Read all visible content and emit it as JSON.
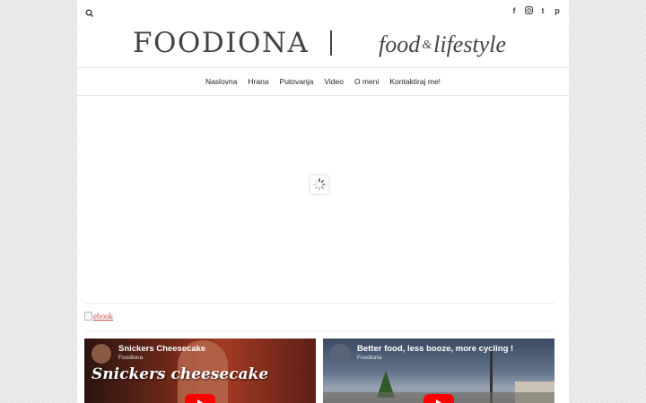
{
  "header": {
    "logo_main": "FOODIONA",
    "tagline_left": "food",
    "tagline_amp": "&",
    "tagline_right": "lifestyle",
    "social_icons": [
      "facebook-icon",
      "instagram-icon",
      "tumblr-icon",
      "pinterest-icon"
    ]
  },
  "nav": {
    "items": [
      "Naslovna",
      "Hrana",
      "Putovanja",
      "Video",
      "O meni",
      "Kontaktiraj me!"
    ]
  },
  "ebook": {
    "alt_text": "ebook"
  },
  "videos": [
    {
      "title": "Snickers Cheesecake",
      "channel": "Foodiona",
      "overlay_text": "Snickers cheesecake"
    },
    {
      "title": "Better food, less booze, more cycling !",
      "channel": "Foodiona"
    }
  ],
  "colors": {
    "background": "#e9e9e9",
    "page": "#ffffff",
    "text": "#444444",
    "link": "#d14b4b",
    "youtube_red": "#ff0000"
  }
}
